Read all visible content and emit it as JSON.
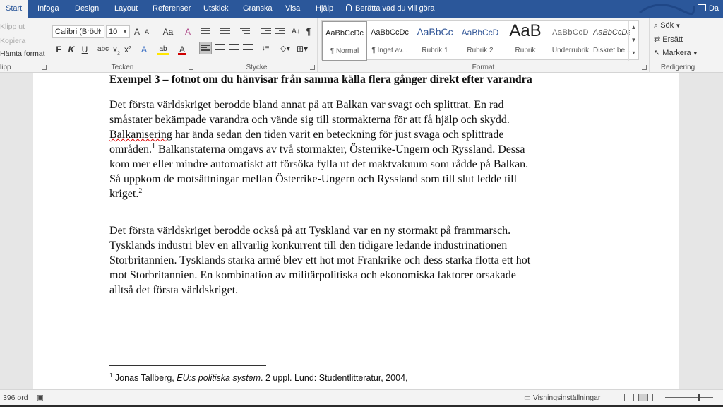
{
  "tabs": [
    {
      "label": "Start",
      "active": true
    },
    {
      "label": "Infoga"
    },
    {
      "label": "Design"
    },
    {
      "label": "Layout"
    },
    {
      "label": "Referenser"
    },
    {
      "label": "Utskick"
    },
    {
      "label": "Granska"
    },
    {
      "label": "Visa"
    },
    {
      "label": "Hjälp"
    }
  ],
  "tell_me": "Berätta vad du vill göra",
  "share_label": "Da",
  "clipboard": {
    "cut": "Klipp ut",
    "copy": "Kopiera",
    "format_painter": "Hämta format",
    "group_label": "lipp"
  },
  "font": {
    "family": "Calibri (Brödt",
    "size": "10",
    "grow": "A",
    "shrink": "A",
    "case": "Aa",
    "clear": "A",
    "bold": "F",
    "italic": "K",
    "underline": "U",
    "strike": "abc",
    "subscript": "x",
    "superscript": "x",
    "effects": "A",
    "highlight": "ab",
    "color": "A",
    "group_label": "Tecken",
    "highlight_color": "#ffe600",
    "font_color": "#d00000"
  },
  "paragraph": {
    "pilcrow": "¶",
    "group_label": "Stycke"
  },
  "styles": {
    "items": [
      {
        "preview": "AaBbCcDc",
        "name": "¶ Normal",
        "selected": true
      },
      {
        "preview": "AaBbCcDc",
        "name": "¶ Inget av..."
      },
      {
        "preview": "AaBbCc",
        "name": "Rubrik 1"
      },
      {
        "preview": "AaBbCcD",
        "name": "Rubrik 2"
      },
      {
        "preview": "AaB",
        "name": "Rubrik"
      },
      {
        "preview": "AaBbCcD",
        "name": "Underrubrik"
      },
      {
        "preview": "AaBbCcDa",
        "name": "Diskret be..."
      }
    ],
    "group_label": "Format",
    "heading_color": "#2f5496"
  },
  "editing": {
    "find": "Sök",
    "replace": "Ersätt",
    "select": "Markera",
    "group_label": "Redigering"
  },
  "document": {
    "heading": "Exempel 3 – fotnot om du hänvisar från samma källa flera gånger direkt efter varandra",
    "para1": {
      "l1": "Det första världskriget berodde bland annat på att Balkan var svagt och splittrat. En rad",
      "l2": "småstater bekämpade varandra och vände sig till stormakterna för att få hjälp och skydd.",
      "l3_a": "Balkanisering",
      "l3_b": " har ända sedan den tiden varit en beteckning för just svaga och splittrade",
      "l4_a": "områden.",
      "l4_sup": "1",
      "l4_b": " Balkanstaterna omgavs av två stormakter, Österrike-Ungern och Ryssland. Dessa",
      "l5": "kom mer eller mindre automatiskt att försöka fylla ut det maktvakuum som rådde på Balkan.",
      "l6": "Så uppkom de motsättningar mellan Österrike-Ungern och Ryssland som till slut ledde till",
      "l7_a": "kriget.",
      "l7_sup": "2"
    },
    "para2": {
      "l1": "Det första världskriget berodde också på att Tyskland var en ny stormakt på frammarsch.",
      "l2": "Tysklands industri blev en allvarlig konkurrent till den tidigare ledande industrinationen",
      "l3": "Storbritannien. Tysklands starka armé blev ett hot mot Frankrike och dess starka flotta ett hot",
      "l4": "mot Storbritannien. En kombination av militärpolitiska och ekonomiska faktorer orsakade",
      "l5": "alltså det första världskriget."
    },
    "footnote": {
      "num": "1",
      "author": " Jonas Tallberg, ",
      "title": "EU:s politiska system",
      "rest": ". 2 uppl. Lund: Studentlitteratur, 2004,"
    }
  },
  "statusbar": {
    "word_count": "396 ord",
    "view_settings": "Visningsinställningar"
  },
  "colors": {
    "accent": "#2b579a"
  }
}
